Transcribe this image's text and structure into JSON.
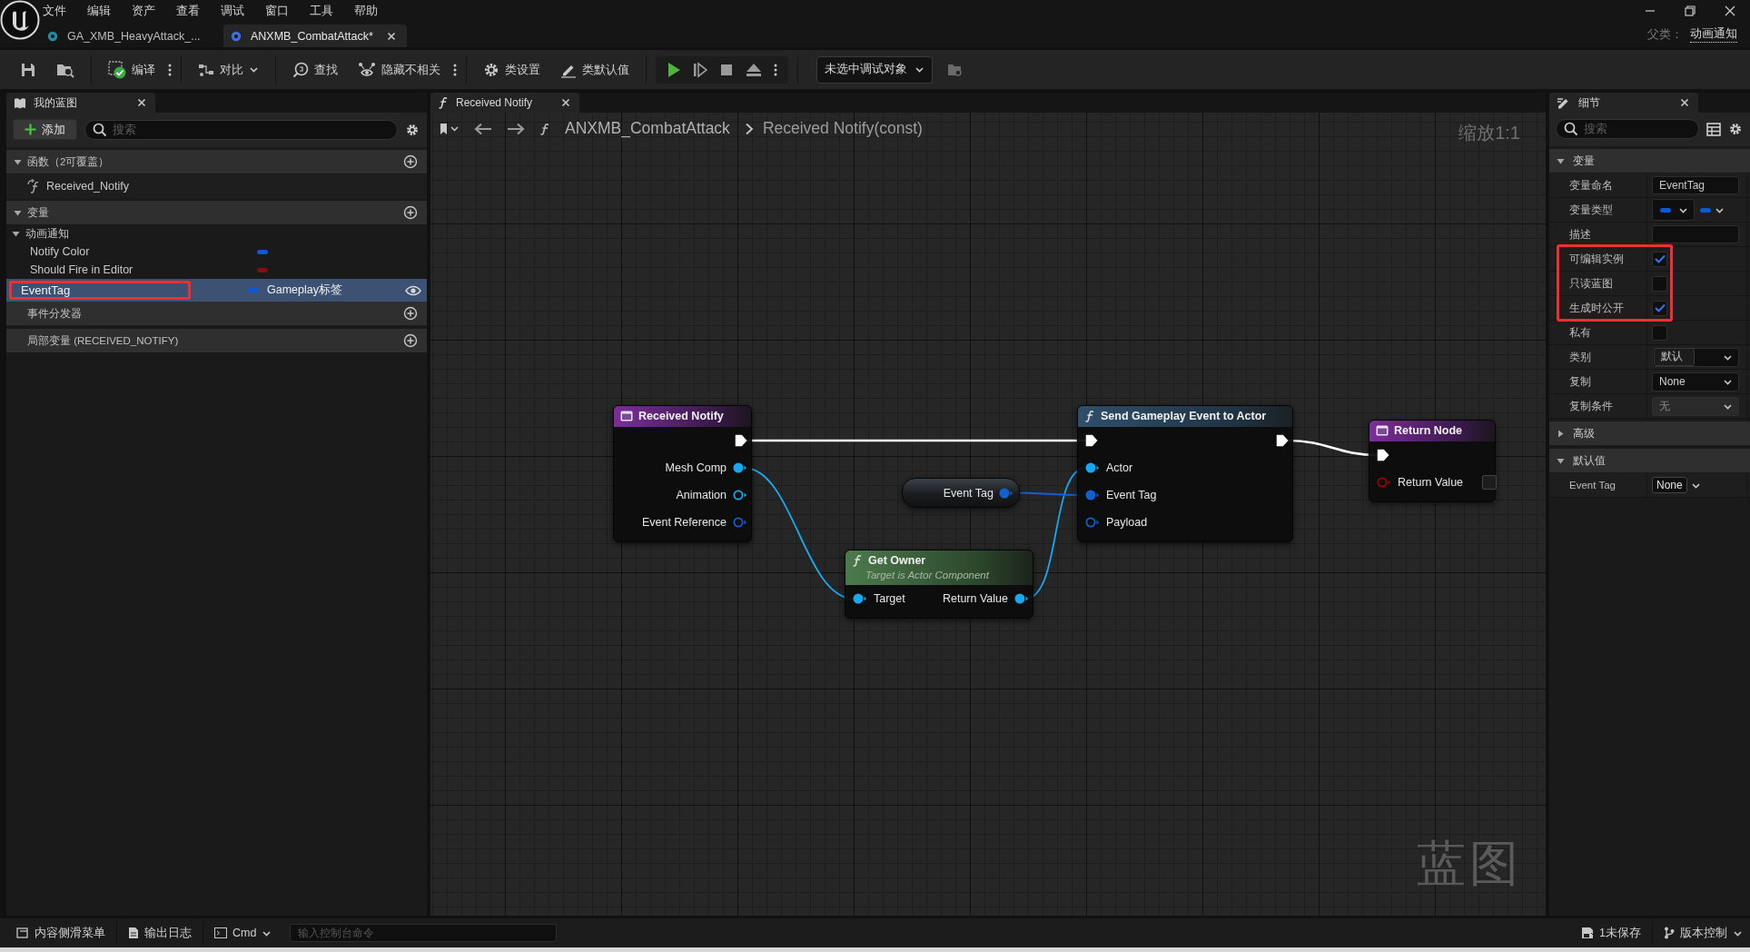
{
  "app": {
    "menu": [
      "文件",
      "编辑",
      "资产",
      "查看",
      "调试",
      "窗口",
      "工具",
      "帮助"
    ],
    "tabs": [
      {
        "label": "GA_XMB_HeavyAttack_...",
        "selected": false,
        "color": "#1a8fa8"
      },
      {
        "label": "ANXMB_CombatAttack*",
        "selected": true,
        "color": "#3a6fe0"
      }
    ],
    "parent_class_label": "父类：",
    "parent_class": "动画通知"
  },
  "toolbar": {
    "compile": "编译",
    "diff": "对比",
    "find": "查找",
    "hide_unrelated": "隐藏不相关",
    "class_settings": "类设置",
    "class_defaults": "类默认值",
    "debug_target": "未选中调试对象"
  },
  "my_blueprint": {
    "tab": "我的蓝图",
    "add_button": "添加",
    "search_placeholder": "搜索",
    "sections": [
      {
        "title": "函数（2可覆盖）",
        "expanded": true,
        "items": [
          {
            "kind": "function",
            "label": "Received_Notify"
          }
        ]
      },
      {
        "title": "变量",
        "expanded": true,
        "items": [
          {
            "kind": "category",
            "label": "动画通知",
            "expanded": true,
            "children": [
              {
                "kind": "variable",
                "label": "Notify Color",
                "color": "#0a5ad8",
                "selected": false,
                "public": false,
                "highlighted": false
              },
              {
                "kind": "variable",
                "label": "Should Fire in Editor",
                "color": "#8a0b0b",
                "selected": false,
                "public": false,
                "highlighted": false
              }
            ]
          },
          {
            "kind": "variable",
            "label": "EventTag",
            "color": "#0a5ad8",
            "type": "Gameplay标签",
            "selected": true,
            "public": true,
            "highlighted": true
          }
        ]
      },
      {
        "title": "事件分发器"
      },
      {
        "title": "局部变量 (RECEIVED_NOTIFY)"
      }
    ]
  },
  "graph": {
    "tab": "Received Notify",
    "breadcrumb": [
      "ANXMB_CombatAttack",
      "Received Notify(const)"
    ],
    "zoom_label": "缩放1:1",
    "graph_type_label": "蓝图",
    "nodes": [
      {
        "kind": "event",
        "title": "Received Notify",
        "outputs": [
          {
            "kind": "exec",
            "connected": true
          },
          {
            "kind": "data",
            "label": "Mesh Comp",
            "color": "#19a8f0",
            "connected": true
          },
          {
            "kind": "data",
            "label": "Animation",
            "color": "#19a8f0",
            "connected": false
          },
          {
            "kind": "data",
            "label": "Event Reference",
            "color": "#1060d0",
            "connected": false
          }
        ]
      },
      {
        "kind": "variable",
        "title": "Event Tag",
        "outputs": [
          {
            "kind": "data",
            "color": "#1060d0",
            "connected": true
          }
        ]
      },
      {
        "kind": "pure",
        "title": "Get Owner",
        "subtitle": "Target is Actor Component",
        "inputs": [
          {
            "kind": "data",
            "label": "Target",
            "color": "#19a8f0",
            "connected": true
          }
        ],
        "outputs": [
          {
            "kind": "data",
            "label": "Return Value",
            "color": "#19a8f0",
            "connected": true
          }
        ]
      },
      {
        "kind": "function",
        "title": "Send Gameplay Event to Actor",
        "inputs": [
          {
            "kind": "exec",
            "connected": true
          },
          {
            "kind": "data",
            "label": "Actor",
            "color": "#19a8f0",
            "connected": true
          },
          {
            "kind": "data",
            "label": "Event Tag",
            "color": "#1060d0",
            "connected": true
          },
          {
            "kind": "data",
            "label": "Payload",
            "color": "#1060d0",
            "connected": false
          }
        ],
        "outputs": [
          {
            "kind": "exec",
            "connected": true
          }
        ]
      },
      {
        "kind": "return",
        "title": "Return Node",
        "inputs": [
          {
            "kind": "exec",
            "connected": true
          },
          {
            "kind": "data",
            "label": "Return Value",
            "color": "#a00000",
            "connected": false,
            "value_box": true
          }
        ]
      }
    ]
  },
  "details": {
    "tab": "细节",
    "search_placeholder": "搜索",
    "sections": [
      {
        "title": "变量",
        "expanded": true,
        "rows": [
          {
            "kind": "text",
            "label": "变量命名",
            "value": "EventTag",
            "highlighted": false
          },
          {
            "kind": "type",
            "label": "变量类型",
            "color": "#0a5ad8",
            "highlighted": false
          },
          {
            "kind": "text",
            "label": "描述",
            "highlighted": false
          },
          {
            "kind": "checkbox",
            "label": "可编辑实例",
            "checked": true,
            "highlighted": true
          },
          {
            "kind": "checkbox",
            "label": "只读蓝图",
            "checked": false,
            "highlighted": true
          },
          {
            "kind": "checkbox",
            "label": "生成时公开",
            "checked": true,
            "highlighted": true
          },
          {
            "kind": "checkbox",
            "label": "私有",
            "checked": false,
            "highlighted": false
          },
          {
            "kind": "chip_combo",
            "label": "类别",
            "value": "默认",
            "highlighted": false
          },
          {
            "kind": "combo",
            "label": "复制",
            "value": "None",
            "disabled": false,
            "highlighted": false
          },
          {
            "kind": "combo",
            "label": "复制条件",
            "value": "无",
            "disabled": true,
            "highlighted": false
          }
        ]
      },
      {
        "title": "高级",
        "expanded": false
      },
      {
        "title": "默认值",
        "expanded": true,
        "rows": [
          {
            "kind": "small_combo",
            "label": "Event Tag",
            "value": "None",
            "highlighted": false
          }
        ]
      }
    ]
  },
  "status_bar": {
    "content_drawer": "内容侧滑菜单",
    "output_log": "输出日志",
    "cmd": "Cmd",
    "console_placeholder": "输入控制台命令",
    "unsaved": "1未保存",
    "source_control": "版本控制"
  }
}
